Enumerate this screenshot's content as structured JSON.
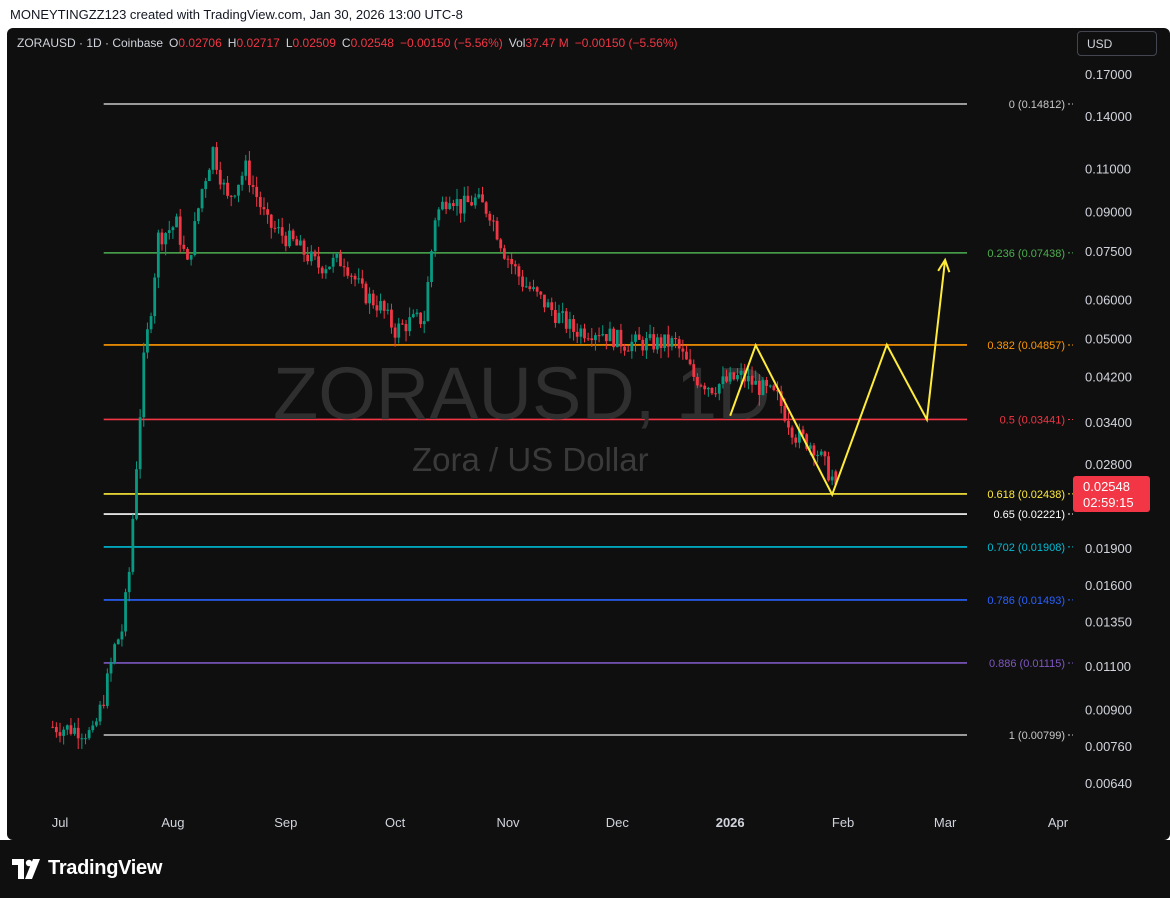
{
  "header": {
    "credit": "MONEYTINGZZ123 created with TradingView.com, Jan 30, 2026 13:00 UTC-8"
  },
  "legend": {
    "symbol": "ZORAUSD · 1D · Coinbase",
    "o_label": "O",
    "o_value": "0.02706",
    "h_label": "H",
    "h_value": "0.02717",
    "l_label": "L",
    "l_value": "0.02509",
    "c_label": "C",
    "c_value": "0.02548",
    "change": "−0.00150 (−5.56%)",
    "vol_label": "Vol",
    "vol_value": "37.47 M",
    "vol_change": "−0.00150 (−5.56%)"
  },
  "currency_button": "USD",
  "watermark": {
    "symbol": "ZORAUSD, 1D",
    "name": "Zora / US Dollar"
  },
  "price_badge": {
    "price": "0.02548",
    "countdown": "02:59:15"
  },
  "brand": {
    "name": "TradingView"
  },
  "colors": {
    "background": "#0f0f0f",
    "up": "#089981",
    "down": "#f23645",
    "projection": "#ffeb3b"
  },
  "chart_data": {
    "type": "candlestick",
    "interval": "1D",
    "y_scale": "log",
    "ylim": [
      0.0058,
      0.185
    ],
    "y_ticks": [
      "0.17000",
      "0.14000",
      "0.11000",
      "0.09000",
      "0.07500",
      "0.06000",
      "0.05000",
      "0.04200",
      "0.03400",
      "0.02800",
      "0.01900",
      "0.01600",
      "0.01350",
      "0.01100",
      "0.00900",
      "0.00760",
      "0.00640"
    ],
    "x_ticks": [
      {
        "label": "Jul",
        "date": "2025-07-01"
      },
      {
        "label": "Aug",
        "date": "2025-08-01"
      },
      {
        "label": "Sep",
        "date": "2025-09-01"
      },
      {
        "label": "Oct",
        "date": "2025-10-01"
      },
      {
        "label": "Nov",
        "date": "2025-11-01"
      },
      {
        "label": "Dec",
        "date": "2025-12-01"
      },
      {
        "label": "2026",
        "date": "2026-01-01",
        "bold": true
      },
      {
        "label": "Feb",
        "date": "2026-02-01"
      },
      {
        "label": "Mar",
        "date": "2026-03-01"
      },
      {
        "label": "Apr",
        "date": "2026-04-01"
      }
    ],
    "price_path": [
      [
        "2025-06-29",
        0.0083
      ],
      [
        "2025-07-06",
        0.0082
      ],
      [
        "2025-07-10",
        0.008
      ],
      [
        "2025-07-13",
        0.0095
      ],
      [
        "2025-07-16",
        0.012
      ],
      [
        "2025-07-18",
        0.013
      ],
      [
        "2025-07-20",
        0.017
      ],
      [
        "2025-07-22",
        0.028
      ],
      [
        "2025-07-24",
        0.045
      ],
      [
        "2025-07-26",
        0.058
      ],
      [
        "2025-07-28",
        0.08
      ],
      [
        "2025-08-02",
        0.085
      ],
      [
        "2025-08-05",
        0.07
      ],
      [
        "2025-08-09",
        0.1
      ],
      [
        "2025-08-12",
        0.12
      ],
      [
        "2025-08-16",
        0.095
      ],
      [
        "2025-08-21",
        0.11
      ],
      [
        "2025-08-27",
        0.085
      ],
      [
        "2025-09-03",
        0.078
      ],
      [
        "2025-09-10",
        0.07
      ],
      [
        "2025-09-17",
        0.072
      ],
      [
        "2025-09-22",
        0.062
      ],
      [
        "2025-09-27",
        0.058
      ],
      [
        "2025-10-01",
        0.052
      ],
      [
        "2025-10-05",
        0.054
      ],
      [
        "2025-10-09",
        0.055
      ],
      [
        "2025-10-12",
        0.088
      ],
      [
        "2025-10-16",
        0.098
      ],
      [
        "2025-10-19",
        0.092
      ],
      [
        "2025-10-23",
        0.095
      ],
      [
        "2025-10-27",
        0.09
      ],
      [
        "2025-10-31",
        0.075
      ],
      [
        "2025-11-05",
        0.065
      ],
      [
        "2025-11-12",
        0.058
      ],
      [
        "2025-11-19",
        0.052
      ],
      [
        "2025-11-26",
        0.052
      ],
      [
        "2025-12-03",
        0.049
      ],
      [
        "2025-12-10",
        0.049
      ],
      [
        "2025-12-17",
        0.049
      ],
      [
        "2025-12-22",
        0.042
      ],
      [
        "2025-12-27",
        0.04
      ],
      [
        "2025-12-31",
        0.041
      ],
      [
        "2026-01-04",
        0.042
      ],
      [
        "2026-01-09",
        0.04
      ],
      [
        "2026-01-14",
        0.038
      ],
      [
        "2026-01-19",
        0.032
      ],
      [
        "2026-01-24",
        0.0305
      ],
      [
        "2026-01-28",
        0.027
      ],
      [
        "2026-01-30",
        0.02548
      ]
    ],
    "fib_levels": [
      {
        "ratio": "0",
        "price": 0.14812,
        "label": "0 (0.14812)",
        "color": "#c8c8c8"
      },
      {
        "ratio": "0.236",
        "price": 0.07438,
        "label": "0.236 (0.07438)",
        "color": "#4caf50"
      },
      {
        "ratio": "0.382",
        "price": 0.04857,
        "label": "0.382 (0.04857)",
        "color": "#ff9800"
      },
      {
        "ratio": "0.5",
        "price": 0.03441,
        "label": "0.5 (0.03441)",
        "color": "#f23645"
      },
      {
        "ratio": "0.618",
        "price": 0.02438,
        "label": "0.618 (0.02438)",
        "color": "#ffeb3b"
      },
      {
        "ratio": "0.65",
        "price": 0.02221,
        "label": "0.65 (0.02221)",
        "color": "#ffffff"
      },
      {
        "ratio": "0.702",
        "price": 0.01908,
        "label": "0.702 (0.01908)",
        "color": "#00bcd4"
      },
      {
        "ratio": "0.786",
        "price": 0.01493,
        "label": "0.786 (0.01493)",
        "color": "#2962ff"
      },
      {
        "ratio": "0.886",
        "price": 0.01115,
        "label": "0.886 (0.01115)",
        "color": "#7e57c2"
      },
      {
        "ratio": "1",
        "price": 0.00799,
        "label": "1 (0.00799)",
        "color": "#c8c8c8"
      }
    ],
    "fib_start_date": "2025-07-13",
    "projection_path": [
      [
        "2026-01-01",
        0.035
      ],
      [
        "2026-01-08",
        0.0485
      ],
      [
        "2026-01-29",
        0.0243
      ],
      [
        "2026-02-13",
        0.0486
      ],
      [
        "2026-02-24",
        0.0344
      ],
      [
        "2026-03-01",
        0.072
      ]
    ],
    "current_price": 0.02548
  }
}
